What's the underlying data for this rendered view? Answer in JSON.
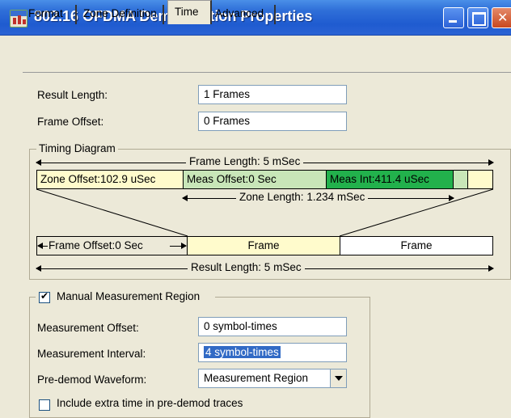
{
  "window": {
    "title": "802.16 OFDMA Demodulation Properties"
  },
  "tabs": [
    {
      "label": "Format"
    },
    {
      "label": "Zone Definition"
    },
    {
      "label": "Time"
    },
    {
      "label": "Advanced"
    }
  ],
  "active_tab": "Time",
  "result_length": {
    "label": "Result Length:",
    "value": "1 Frames"
  },
  "frame_offset": {
    "label": "Frame Offset:",
    "value": "0 Frames"
  },
  "timing_diagram": {
    "title": "Timing Diagram",
    "frame_length": "Frame Length:  5 mSec",
    "zone_offset": "Zone Offset:102.9 uSec",
    "meas_offset": "Meas Offset:0 Sec",
    "meas_int": "Meas Int:411.4 uSec",
    "zone_length": "Zone Length: 1.234 mSec",
    "frame_offset_label": "Frame Offset:0 Sec",
    "frame1": "Frame",
    "frame2": "Frame",
    "result_length": "Result Length: 5 mSec",
    "colors": {
      "meas_offset_fill": "#c8e6b8",
      "meas_int_fill": "#22b14c",
      "frame_fill": "#fffbcc"
    }
  },
  "manual_region": {
    "label": "Manual Measurement Region",
    "checked": true,
    "measurement_offset": {
      "label": "Measurement Offset:",
      "value": "0 symbol-times"
    },
    "measurement_interval": {
      "label": "Measurement Interval:",
      "value": "4 symbol-times"
    },
    "predemod_waveform": {
      "label": "Pre-demod Waveform:",
      "value": "Measurement Region"
    },
    "include_extra": {
      "label": "Include extra time in pre-demod traces",
      "checked": false
    }
  }
}
